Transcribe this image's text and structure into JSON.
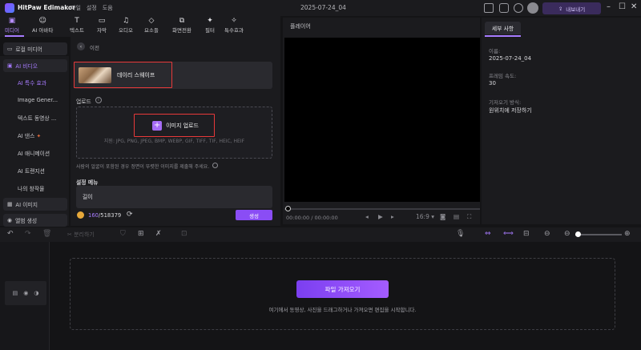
{
  "app": {
    "name": "HitPaw Edimakor",
    "menu": [
      "파일",
      "설정",
      "도움"
    ],
    "project_name": "2025-07-24_04",
    "export_label": "내보내기"
  },
  "toolbar": {
    "tabs": [
      {
        "label": "미디어",
        "icon": "media-icon"
      },
      {
        "label": "AI 아바타",
        "icon": "avatar-icon"
      },
      {
        "label": "텍스트",
        "icon": "text-icon"
      },
      {
        "label": "자막",
        "icon": "subtitle-icon"
      },
      {
        "label": "오디오",
        "icon": "audio-icon"
      },
      {
        "label": "요소들",
        "icon": "elements-icon"
      },
      {
        "label": "화면전환",
        "icon": "transition-icon"
      },
      {
        "label": "필터",
        "icon": "filter-icon"
      },
      {
        "label": "특수효과",
        "icon": "effects-icon"
      }
    ],
    "active_tab": "미디어"
  },
  "sidebar": {
    "local_media": "로컬 미디어",
    "ai_video": "AI 비디오",
    "sub_items": [
      "AI 특수 효과",
      "Image Gener...",
      "텍스트 동영상 ...",
      "AI 댄스",
      "AI 애니메이션",
      "AI 트랜지션",
      "나의 창작물"
    ],
    "active_sub": "AI 특수 효과",
    "ai_image": "AI 이미지",
    "album": "앨범 생성"
  },
  "panel": {
    "back_label": "이전",
    "style_name": "데이리 스웨이프",
    "upload_label": "업로드",
    "upload_button": "이미지 업로드",
    "formats": "지원: JPG, PNG, JPEG, BMP, WEBP, GIF, TIFF, TIF, HEIC, HEIF",
    "privacy": "사람의 얼굴이 포함된 경우 정면이 뚜렷한 이미지를 제출해 주세요.",
    "settings_title": "설정 메뉴",
    "settings_length": "길이",
    "credits_used": "160",
    "credits_total": "/518379",
    "generate_label": "생성"
  },
  "player": {
    "title": "플레이어",
    "timecode": "00:00:00 / 00:00:00",
    "aspect": "16:9"
  },
  "details": {
    "tab": "세부 사항",
    "name_label": "이름:",
    "name_value": "2025-07-24_04",
    "fps_label": "프레임 속도:",
    "fps_value": "30",
    "save_label": "기저오기 방식:",
    "save_value": "원위치에 저장하기"
  },
  "timeline": {
    "split_label": "분리하기",
    "import_button": "파일 가져오기",
    "hint": "여기에서 동영상, 사진을 드래그하거나 가져오면 편집을 시작합니다."
  },
  "colors": {
    "accent": "#a77bff",
    "highlight_box": "#e8393a",
    "background": "#141416"
  }
}
